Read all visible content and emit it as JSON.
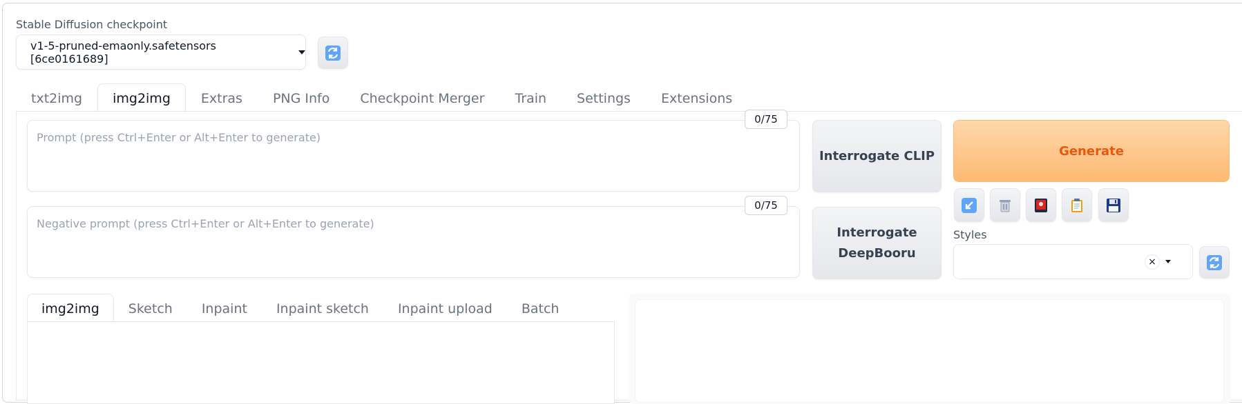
{
  "checkpoint": {
    "label": "Stable Diffusion checkpoint",
    "selected": "v1-5-pruned-emaonly.safetensors [6ce0161689]",
    "refresh_icon": "refresh-icon"
  },
  "main_tabs": [
    "txt2img",
    "img2img",
    "Extras",
    "PNG Info",
    "Checkpoint Merger",
    "Train",
    "Settings",
    "Extensions"
  ],
  "active_main_tab": "img2img",
  "prompt": {
    "placeholder": "Prompt (press Ctrl+Enter or Alt+Enter to generate)",
    "value": "",
    "token_count": "0/75"
  },
  "negative_prompt": {
    "placeholder": "Negative prompt (press Ctrl+Enter or Alt+Enter to generate)",
    "value": "",
    "token_count": "0/75"
  },
  "buttons": {
    "interrogate_clip": "Interrogate CLIP",
    "interrogate_deepbooru_line1": "Interrogate",
    "interrogate_deepbooru_line2": "DeepBooru",
    "generate": "Generate"
  },
  "tools": [
    "arrow-down-left-icon",
    "trash-icon",
    "red-card-icon",
    "clipboard-icon",
    "save-icon"
  ],
  "styles": {
    "label": "Styles",
    "clear": "×"
  },
  "sub_tabs": [
    "img2img",
    "Sketch",
    "Inpaint",
    "Inpaint sketch",
    "Inpaint upload",
    "Batch"
  ],
  "active_sub_tab": "img2img",
  "colors": {
    "generate_bg": "#fdba74",
    "generate_text": "#ea580c",
    "refresh_blue": "#3b82f6"
  }
}
